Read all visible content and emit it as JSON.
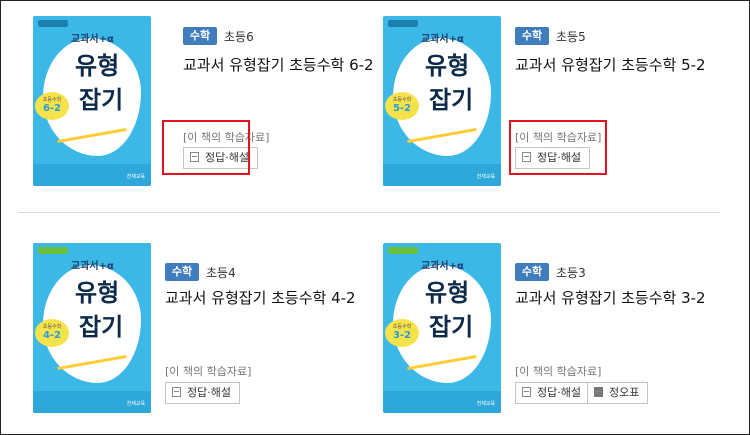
{
  "books": [
    {
      "subject": "수학",
      "grade": "초등6",
      "title": "교과서 유형잡기 초등수학 6-2",
      "cover_grade": "6-2",
      "cover_small": "초등수학",
      "resources_label": "[이 책의 학습자료]",
      "buttons": [
        {
          "label": "정답·해설",
          "icon": "answer-icon"
        }
      ],
      "highlighted": true
    },
    {
      "subject": "수학",
      "grade": "초등5",
      "title": "교과서 유형잡기 초등수학 5-2",
      "cover_grade": "5-2",
      "cover_small": "초등수학",
      "resources_label": "[이 책의 학습자료]",
      "buttons": [
        {
          "label": "정답·해설",
          "icon": "answer-icon"
        }
      ],
      "highlighted": true
    },
    {
      "subject": "수학",
      "grade": "초등4",
      "title": "교과서 유형잡기 초등수학 4-2",
      "cover_grade": "4-2",
      "cover_small": "초등수학",
      "resources_label": "[이 책의 학습자료]",
      "buttons": [
        {
          "label": "정답·해설",
          "icon": "answer-icon"
        }
      ],
      "highlighted": false
    },
    {
      "subject": "수학",
      "grade": "초등3",
      "title": "교과서 유형잡기 초등수학 3-2",
      "cover_grade": "3-2",
      "cover_small": "초등수학",
      "resources_label": "[이 책의 학습자료]",
      "buttons": [
        {
          "label": "정답·해설",
          "icon": "answer-icon"
        },
        {
          "label": "정오표",
          "icon": "errata-icon"
        }
      ],
      "highlighted": false
    }
  ],
  "cover": {
    "brand": "교과서+α",
    "line1": "유형",
    "line2": "잡기",
    "publisher": "천재교육"
  },
  "colors": {
    "subject_badge": "#3f7dbf",
    "highlight": "#e0141e",
    "cover_blue": "#3bb8e6"
  }
}
